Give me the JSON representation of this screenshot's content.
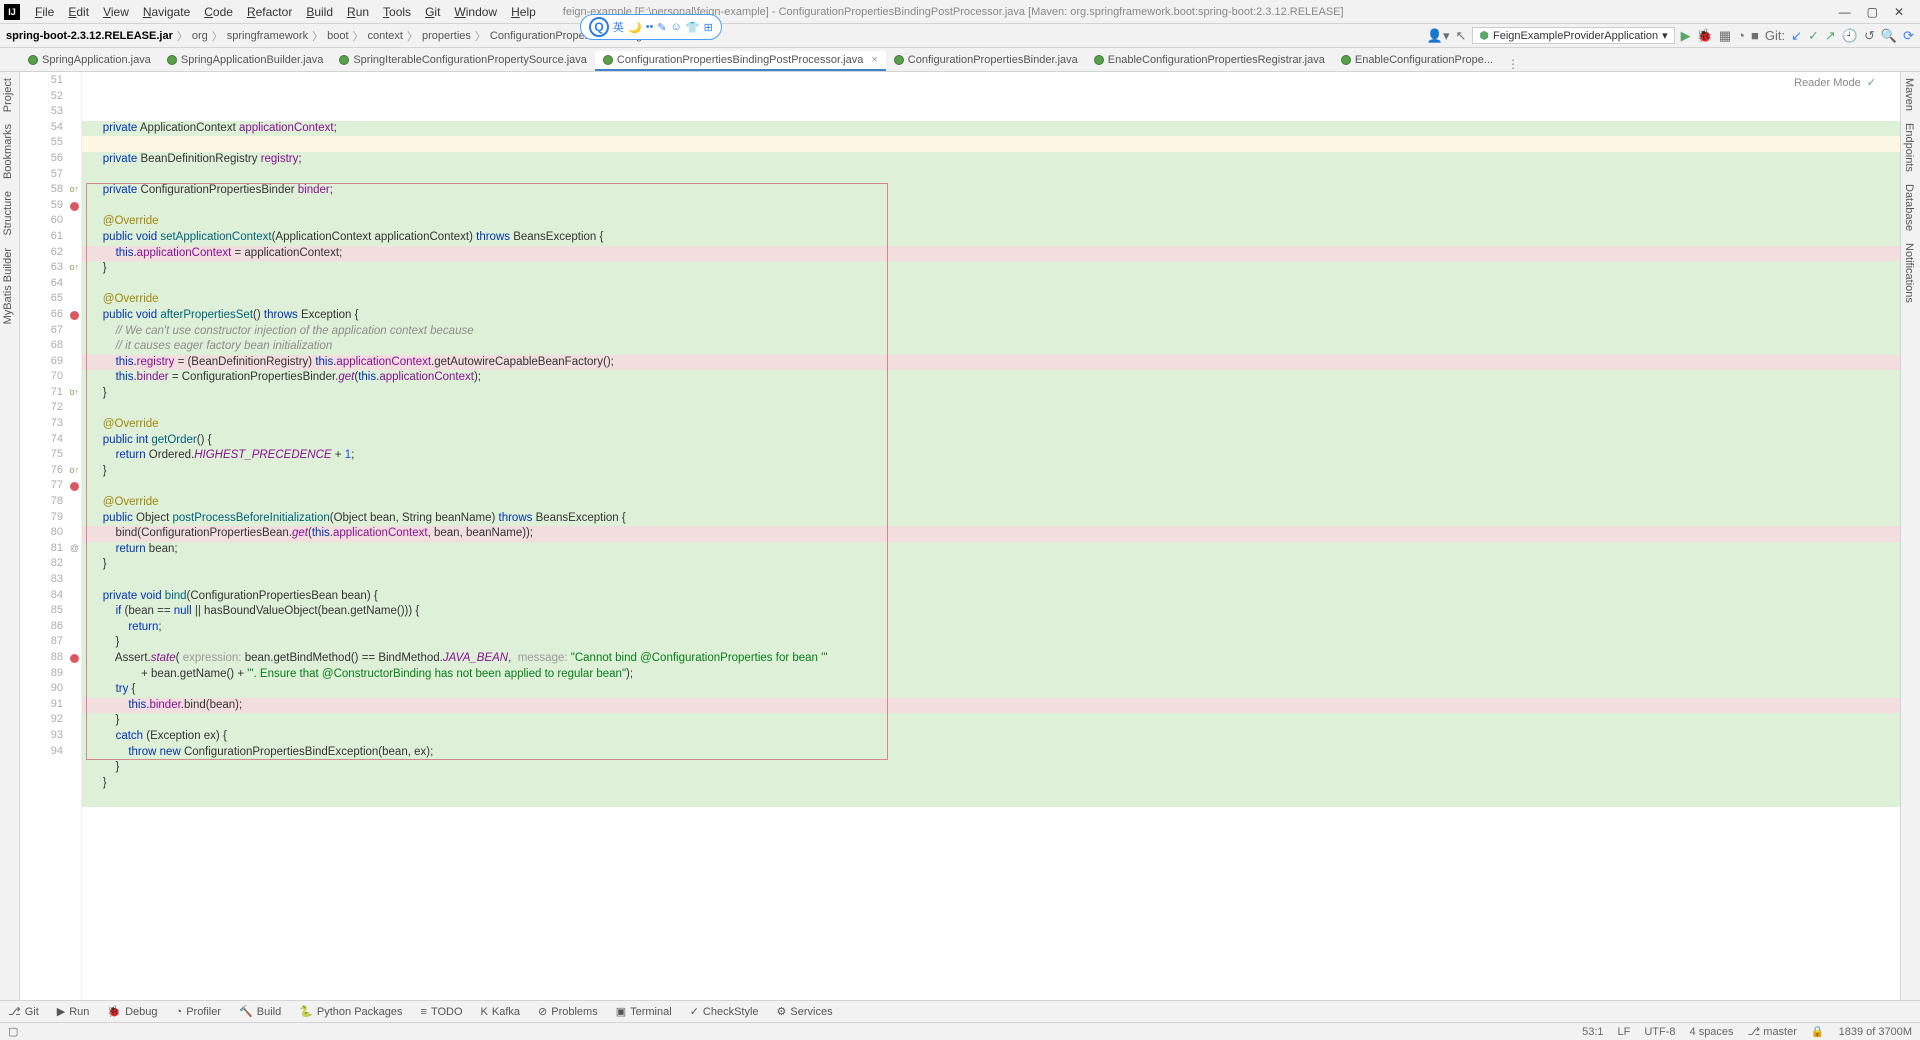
{
  "menu": {
    "items": [
      "File",
      "Edit",
      "View",
      "Navigate",
      "Code",
      "Refactor",
      "Build",
      "Run",
      "Tools",
      "Git",
      "Window",
      "Help"
    ],
    "title": "feign-example [E:\\personal\\feign-example] - ConfigurationPropertiesBindingPostProcessor.java [Maven: org.springframework.boot:spring-boot:2.3.12.RELEASE]"
  },
  "overlay": {
    "ime": "英"
  },
  "crumbs": [
    "spring-boot-2.3.12.RELEASE.jar",
    "org",
    "springframework",
    "boot",
    "context",
    "properties",
    "ConfigurationPropertiesBindingPostProcessor"
  ],
  "runConfig": "FeignExampleProviderApplication",
  "git": "Git:",
  "tabs": [
    {
      "label": "SpringApplication.java"
    },
    {
      "label": "SpringApplicationBuilder.java"
    },
    {
      "label": "SpringIterableConfigurationPropertySource.java"
    },
    {
      "label": "ConfigurationPropertiesBindingPostProcessor.java",
      "active": true
    },
    {
      "label": "ConfigurationPropertiesBinder.java"
    },
    {
      "label": "EnableConfigurationPropertiesRegistrar.java"
    },
    {
      "label": "EnableConfigurationPrope..."
    }
  ],
  "readerMode": "Reader Mode",
  "leftTabs": [
    "Project",
    "Bookmarks",
    "Structure",
    "MyBatis Builder"
  ],
  "rightTabs": [
    "Maven",
    "Endpoints",
    "Database",
    "Notifications"
  ],
  "bottom": [
    {
      "icon": "⎇",
      "label": "Git"
    },
    {
      "icon": "▶",
      "label": "Run"
    },
    {
      "icon": "🐞",
      "label": "Debug"
    },
    {
      "icon": "◔",
      "label": "Profiler"
    },
    {
      "icon": "🔨",
      "label": "Build"
    },
    {
      "icon": "🐍",
      "label": "Python Packages"
    },
    {
      "icon": "≡",
      "label": "TODO"
    },
    {
      "icon": "K",
      "label": "Kafka"
    },
    {
      "icon": "⊘",
      "label": "Problems"
    },
    {
      "icon": "▣",
      "label": "Terminal"
    },
    {
      "icon": "✓",
      "label": "CheckStyle"
    },
    {
      "icon": "⚙",
      "label": "Services"
    }
  ],
  "status": {
    "pos": "53:1",
    "le": "LF",
    "enc": "UTF-8",
    "indent": "4 spaces",
    "branch": "master",
    "mem": "1839 of 3700M"
  },
  "code": {
    "start": 51,
    "lines": [
      {
        "bg": "g",
        "html": "    <span class='kw'>private</span> ApplicationContext <span class='fld'>applicationContext</span>;"
      },
      {
        "bg": "y",
        "html": ""
      },
      {
        "bg": "g",
        "html": "    <span class='kw'>private</span> BeanDefinitionRegistry <span class='fld'>registry</span>;"
      },
      {
        "bg": "g",
        "html": ""
      },
      {
        "bg": "g",
        "html": "    <span class='kw'>private</span> ConfigurationPropertiesBinder <span class='fld'>binder</span>;"
      },
      {
        "bg": "g",
        "html": ""
      },
      {
        "bg": "g",
        "html": "    <span class='ann'>@Override</span>"
      },
      {
        "bg": "g",
        "ov": 1,
        "html": "    <span class='kw'>public void</span> <span class='fn'>setApplicationContext</span>(ApplicationContext applicationContext) <span class='kw'>throws</span> BeansException {"
      },
      {
        "bg": "r",
        "bp": 1,
        "html": "        <span class='kw'>this</span>.<span class='fld'>applicationContext</span> = applicationContext;"
      },
      {
        "bg": "g",
        "html": "    }"
      },
      {
        "bg": "g",
        "html": ""
      },
      {
        "bg": "g",
        "html": "    <span class='ann'>@Override</span>"
      },
      {
        "bg": "g",
        "ov": 1,
        "html": "    <span class='kw'>public void</span> <span class='fn'>afterPropertiesSet</span>() <span class='kw'>throws</span> Exception {"
      },
      {
        "bg": "g",
        "html": "        <span class='cmt'>// We can't use constructor injection of the application context because</span>"
      },
      {
        "bg": "g",
        "html": "        <span class='cmt'>// it causes eager factory bean initialization</span>"
      },
      {
        "bg": "r",
        "bp": 1,
        "html": "        <span class='kw'>this</span>.<span class='fld'>registry</span> = (BeanDefinitionRegistry) <span class='kw'>this</span>.<span class='fld'>applicationContext</span>.getAutowireCapableBeanFactory();"
      },
      {
        "bg": "g",
        "html": "        <span class='kw'>this</span>.<span class='fld'>binder</span> = ConfigurationPropertiesBinder.<span class='sta'>get</span>(<span class='kw'>this</span>.<span class='fld'>applicationContext</span>);"
      },
      {
        "bg": "g",
        "html": "    }"
      },
      {
        "bg": "g",
        "html": ""
      },
      {
        "bg": "g",
        "html": "    <span class='ann'>@Override</span>"
      },
      {
        "bg": "g",
        "ov": 1,
        "html": "    <span class='kw'>public int</span> <span class='fn'>getOrder</span>() {"
      },
      {
        "bg": "g",
        "html": "        <span class='kw'>return</span> Ordered.<span class='sta'>HIGHEST_PRECEDENCE</span> + <span class='num'>1</span>;"
      },
      {
        "bg": "g",
        "html": "    }"
      },
      {
        "bg": "g",
        "html": ""
      },
      {
        "bg": "g",
        "html": "    <span class='ann'>@Override</span>"
      },
      {
        "bg": "g",
        "ov": 1,
        "html": "    <span class='kw'>public</span> Object <span class='fn'>postProcessBeforeInitialization</span>(Object bean, String beanName) <span class='kw'>throws</span> BeansException {"
      },
      {
        "bg": "r",
        "bp": 1,
        "html": "        bind(ConfigurationPropertiesBean.<span class='sta'>get</span>(<span class='kw'>this</span>.<span class='fld'>applicationContext</span>, bean, beanName));"
      },
      {
        "bg": "g",
        "html": "        <span class='kw'>return</span> bean;"
      },
      {
        "bg": "g",
        "html": "    }"
      },
      {
        "bg": "g",
        "html": ""
      },
      {
        "bg": "g",
        "at": 1,
        "html": "    <span class='kw'>private void</span> <span class='fn'>bind</span>(ConfigurationPropertiesBean bean) {"
      },
      {
        "bg": "g",
        "html": "        <span class='kw'>if</span> (bean == <span class='kw'>null</span> || hasBoundValueObject(bean.getName())) {"
      },
      {
        "bg": "g",
        "html": "            <span class='kw'>return</span>;"
      },
      {
        "bg": "g",
        "html": "        }"
      },
      {
        "bg": "g",
        "html": "        Assert.<span class='sta'>state</span>( <span class='hint'>expression:</span> bean.getBindMethod() == BindMethod.<span class='sta'>JAVA_BEAN</span>,  <span class='hint'>message:</span> <span class='str'>\"Cannot bind @ConfigurationProperties for bean '\"</span>"
      },
      {
        "bg": "g",
        "html": "                + bean.getName() + <span class='str'>\"'. Ensure that @ConstructorBinding has not been applied to regular bean\"</span>);"
      },
      {
        "bg": "g",
        "html": "        <span class='kw'>try</span> {"
      },
      {
        "bg": "r",
        "bp": 1,
        "html": "            <span class='kw'>this</span>.<span class='fld'>binder</span>.bind(bean);"
      },
      {
        "bg": "g",
        "html": "        }"
      },
      {
        "bg": "g",
        "html": "        <span class='kw'>catch</span> (Exception ex) {"
      },
      {
        "bg": "g",
        "html": "            <span class='kw'>throw new</span> ConfigurationPropertiesBindException(bean, ex);"
      },
      {
        "bg": "g",
        "html": "        }"
      },
      {
        "bg": "g",
        "html": "    }"
      },
      {
        "bg": "g",
        "html": ""
      }
    ]
  }
}
